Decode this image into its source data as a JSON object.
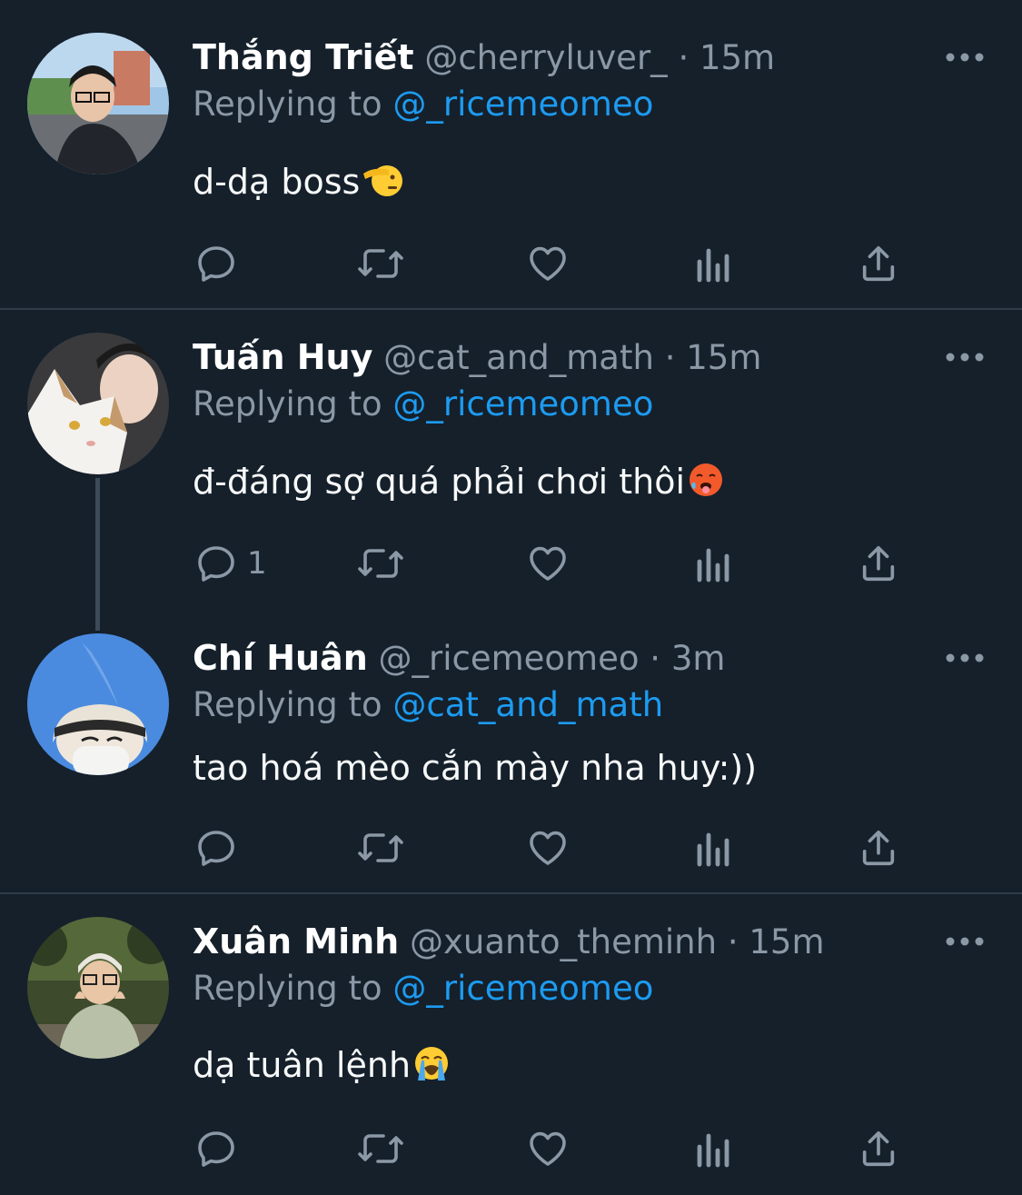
{
  "tweets": [
    {
      "name": "Thắng Triết",
      "handle": "@cherryluver_",
      "separator": "·",
      "time": "15m",
      "replying_prefix": "Replying to",
      "replying_to": "@_ricemeomeo",
      "text": "d-dạ boss",
      "emoji": "saluting-face",
      "reply_count": "",
      "avatar": "avatar-photo-boy-glasses"
    },
    {
      "name": "Tuấn Huy",
      "handle": "@cat_and_math",
      "separator": "·",
      "time": "15m",
      "replying_prefix": "Replying to",
      "replying_to": "@_ricemeomeo",
      "text": "đ-đáng sợ quá phải chơi thôi",
      "emoji": "hot-face",
      "reply_count": "1",
      "avatar": "avatar-photo-boy-with-cat"
    },
    {
      "name": "Chí Huân",
      "handle": "@_ricemeomeo",
      "separator": "·",
      "time": "3m",
      "replying_prefix": "Replying to",
      "replying_to": "@cat_and_math",
      "text": "tao hoá mèo cắn mày nha huy:))",
      "emoji": "",
      "reply_count": "",
      "avatar": "avatar-photo-sky-beanie"
    },
    {
      "name": "Xuân Minh",
      "handle": "@xuanto_theminh",
      "separator": "·",
      "time": "15m",
      "replying_prefix": "Replying to",
      "replying_to": "@_ricemeomeo",
      "text": "dạ tuân lệnh",
      "emoji": "loudly-crying-face",
      "reply_count": "",
      "avatar": "avatar-photo-boy-park"
    }
  ],
  "icons": {
    "reply": "reply-icon",
    "retweet": "retweet-icon",
    "like": "heart-icon",
    "views": "views-icon",
    "share": "share-icon",
    "more": "more-icon"
  },
  "colors": {
    "background": "#15202b",
    "text": "#f7f9f9",
    "muted": "#8b98a5",
    "accent": "#1d9bf0",
    "divider": "#2f3b47"
  }
}
